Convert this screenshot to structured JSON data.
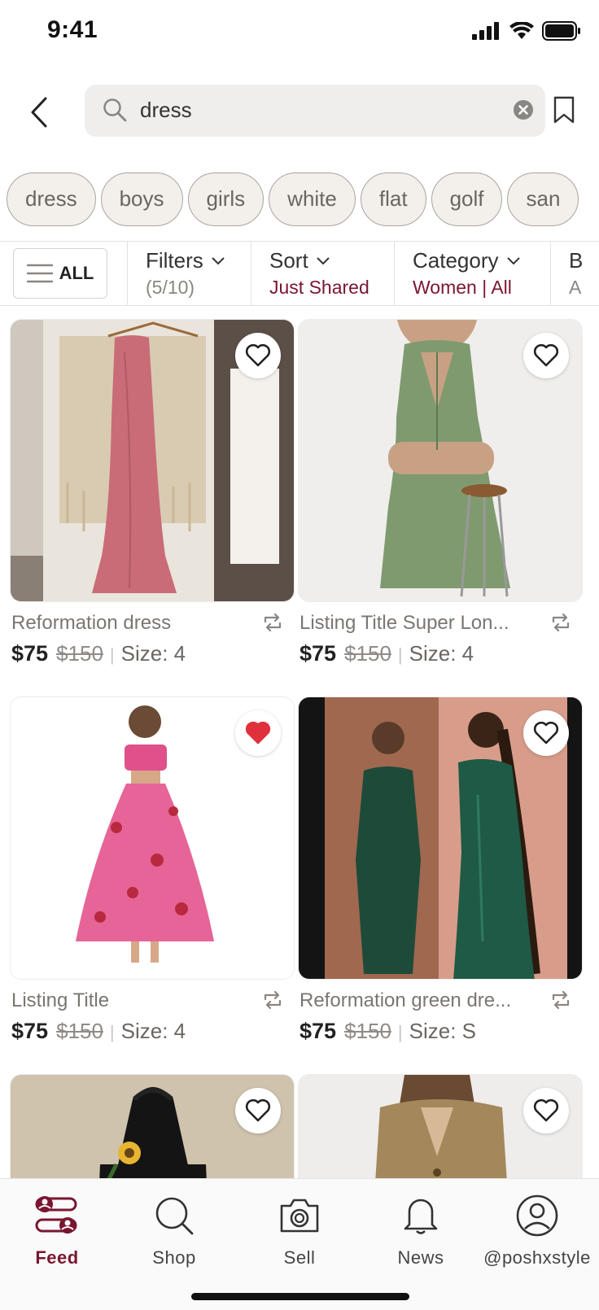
{
  "status_bar": {
    "time": "9:41"
  },
  "search": {
    "query": "dress"
  },
  "chips": [
    "dress",
    "boys",
    "girls",
    "white",
    "flat",
    "golf",
    "san"
  ],
  "filter_bar": {
    "all_label": "ALL",
    "filters": {
      "title": "Filters",
      "sub": "(5/10)"
    },
    "sort": {
      "title": "Sort",
      "sub": "Just Shared"
    },
    "category": {
      "title": "Category",
      "sub": "Women | All"
    },
    "brand_partial": {
      "title": "B",
      "sub": "A"
    }
  },
  "listings": [
    {
      "title": "Reformation dress",
      "price": "$75",
      "original_price": "$150",
      "size": "Size: 4",
      "liked": false
    },
    {
      "title": "Listing Title Super Lon...",
      "price": "$75",
      "original_price": "$150",
      "size": "Size: 4",
      "liked": false
    },
    {
      "title": "Listing Title",
      "price": "$75",
      "original_price": "$150",
      "size": "Size: 4",
      "liked": true
    },
    {
      "title": "Reformation green dre...",
      "price": "$75",
      "original_price": "$150",
      "size": "Size: S",
      "liked": false
    },
    {
      "title": "",
      "liked": false
    },
    {
      "title": "",
      "liked": false
    }
  ],
  "nav": {
    "feed": "Feed",
    "shop": "Shop",
    "sell": "Sell",
    "news": "News",
    "profile": "@poshxstyle"
  },
  "colors": {
    "accent": "#7a1630",
    "heart_liked": "#e0303c",
    "chip_bg": "#f3f0ec"
  }
}
